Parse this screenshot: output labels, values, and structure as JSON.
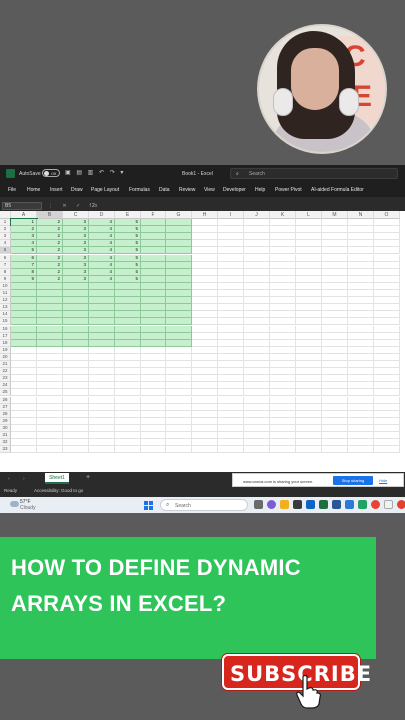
{
  "excel": {
    "autosave_label": "AutoSave",
    "autosave_state": "Off",
    "doc_title": "Book1 - Excel",
    "search_placeholder": "Search",
    "menu": [
      "File",
      "Home",
      "Insert",
      "Draw",
      "Page Layout",
      "Formulas",
      "Data",
      "Review",
      "View",
      "Developer",
      "Help",
      "Power Pivot",
      "AI-aided Formula Editor"
    ],
    "name_box": "B5",
    "formula_value": "2",
    "columns": [
      "A",
      "B",
      "C",
      "D",
      "E",
      "F",
      "G",
      "H",
      "I",
      "J",
      "K",
      "L",
      "M",
      "N",
      "O"
    ],
    "rows": [
      "1",
      "2",
      "3",
      "4",
      "5",
      "6",
      "7",
      "8",
      "9",
      "10",
      "11",
      "12",
      "13",
      "14",
      "15",
      "16",
      "17",
      "18",
      "19",
      "20",
      "21",
      "22",
      "23",
      "24",
      "25",
      "26",
      "27",
      "28",
      "29",
      "30",
      "31",
      "32",
      "33"
    ],
    "data": [
      [
        "1",
        "2",
        "3",
        "4",
        "5"
      ],
      [
        "2",
        "2",
        "3",
        "4",
        "5"
      ],
      [
        "3",
        "2",
        "3",
        "4",
        "5"
      ],
      [
        "4",
        "2",
        "3",
        "4",
        "5"
      ],
      [
        "5",
        "2",
        "3",
        "4",
        "5"
      ],
      [
        "6",
        "2",
        "3",
        "4",
        "5"
      ],
      [
        "7",
        "2",
        "3",
        "4",
        "5"
      ],
      [
        "8",
        "2",
        "3",
        "4",
        "5"
      ],
      [
        "9",
        "2",
        "3",
        "4",
        "5"
      ]
    ],
    "sheet_tab": "Sheet1",
    "status_ready": "Ready",
    "status_accessibility": "Accessibility: Good to go",
    "share_message": "www.canva.com is sharing your screen.",
    "stop_sharing": "Stop sharing",
    "hide": "Hide",
    "highlight_color": "#c6efce"
  },
  "taskbar": {
    "temperature": "57°F",
    "weather": "Cloudy",
    "search_placeholder": "Search"
  },
  "banner": {
    "line1": "HOW TO DEFINE DYNAMIC",
    "line2": "ARRAYS IN EXCEL?",
    "color": "#2ec45a"
  },
  "subscribe": {
    "label": "SUBSCRIBE",
    "color": "#d7261e"
  }
}
